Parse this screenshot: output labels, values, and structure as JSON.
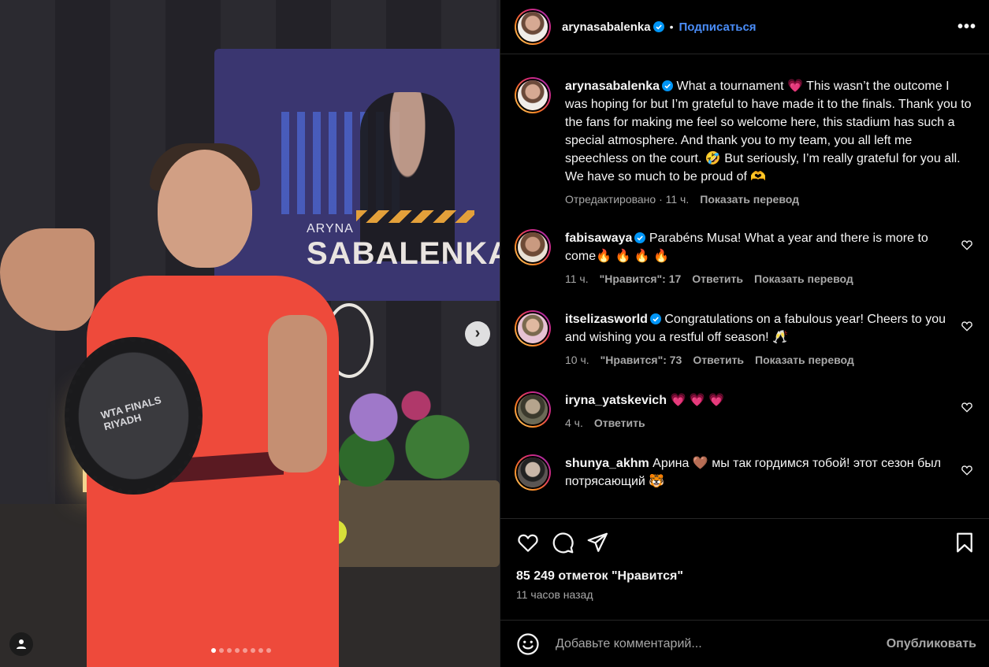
{
  "colors": {
    "background": "#000000",
    "link_blue": "#4a8df8",
    "secondary_text": "#a8a8a8",
    "verified_blue": "#0095f6",
    "divider": "#262626"
  },
  "media": {
    "banner_name_small": "ARYNA",
    "banner_name_big": "SABALENKA",
    "trophy_text": "WTA FINALS RIYADH",
    "next_icon": "chevron-right-icon",
    "carousel_count": 8,
    "carousel_active_index": 0
  },
  "header": {
    "username": "arynasabalenka",
    "follow_label": "Подписаться",
    "separator": "•",
    "more_label": "•••"
  },
  "caption": {
    "username": "arynasabalenka",
    "text": "What a tournament 💗 This wasn’t the outcome I was hoping for but I’m grateful to have made it to the finals. Thank you to the fans for making me feel so welcome here, this stadium has such a special atmosphere. And thank you to my team, you all left me speechless on the court. 🤣 But seriously, I’m really grateful for you all. We have so much to be proud of 🫶",
    "edited": "Отредактировано · 11 ч.",
    "translate": "Показать перевод"
  },
  "comments": [
    {
      "username": "fabisawaya",
      "verified": true,
      "text": "Parabéns Musa! What a year and there is more to come🔥 🔥 🔥 🔥",
      "time": "11 ч.",
      "likes": "\"Нравится\": 17",
      "reply": "Ответить",
      "translate": "Показать перевод"
    },
    {
      "username": "itselizasworld",
      "verified": true,
      "text": "Congratulations on a fabulous year! Cheers to you and wishing you a restful off season! 🥂",
      "time": "10 ч.",
      "likes": "\"Нравится\": 73",
      "reply": "Ответить",
      "translate": "Показать перевод"
    },
    {
      "username": "iryna_yatskevich",
      "verified": false,
      "text": "💗 💗 💗",
      "time": "4 ч.",
      "likes": "",
      "reply": "Ответить",
      "translate": ""
    },
    {
      "username": "shunya_akhm",
      "verified": false,
      "text": "Арина 🤎 мы так гордимся тобой! этот сезон был потрясающий 🐯",
      "time": "",
      "likes": "",
      "reply": "",
      "translate": ""
    }
  ],
  "actions": {
    "like_icon": "heart-icon",
    "comment_icon": "comment-icon",
    "share_icon": "share-icon",
    "save_icon": "bookmark-icon",
    "likes_text": "85 249 отметок \"Нравится\"",
    "time_text": "11 часов назад"
  },
  "add_comment": {
    "emoji_icon": "emoji-icon",
    "placeholder": "Добавьте комментарий...",
    "publish_label": "Опубликовать"
  }
}
